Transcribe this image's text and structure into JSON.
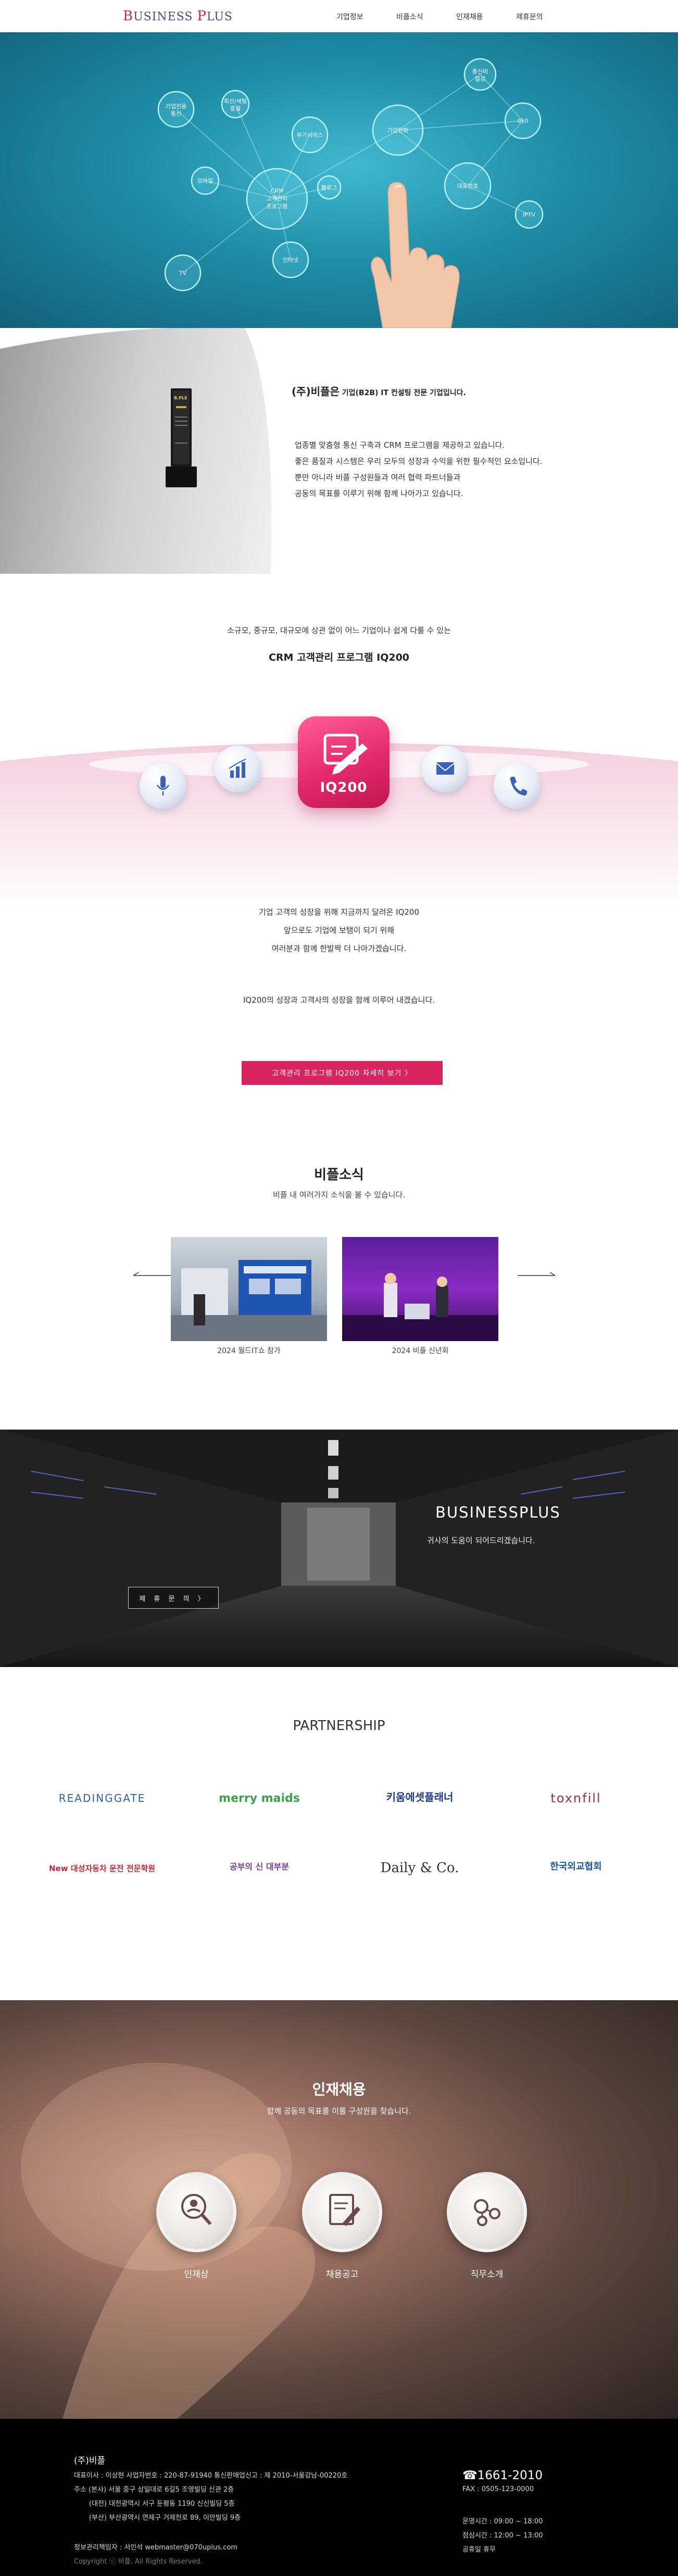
{
  "header": {
    "logo_first": "B",
    "logo_mid": "USINESS ",
    "logo_second": "P",
    "logo_end": "LUS",
    "nav": [
      "기업정보",
      "비플소식",
      "인재채용",
      "제휴문의"
    ]
  },
  "hero": {
    "nodes": [
      "CRM\n고객관리\n프로그램",
      "기업전화",
      "대표번호",
      "050",
      "통신비\n절감",
      "IPTV",
      "부가서비스",
      "회선/세팅\n증설",
      "기업전용\n통신",
      "모바일",
      "블로그",
      "인터넷",
      "TV"
    ]
  },
  "intro": {
    "title_main": "(주)비플은",
    "title_small": " 기업(B2B) IT 컨설팅 전문 기업입니다.",
    "lines": [
      "업종별 맞춤형 통신 구축과 CRM 프로그램을 제공하고 있습니다.",
      "좋은 품질과 시스템은 우리 모두의 성장과 수익을 위한 필수적인 요소입니다.",
      "뿐만 아니라 비플 구성원들과 여러 협력 파트너들과",
      "공동의 목표를 이루기 위해 함께 나아가고 있습니다."
    ],
    "award_label": "B.PLE"
  },
  "crm": {
    "subtitle": "소규모, 중규모, 대규모에 상관 없이 어느 기업이나 쉽게 다룰 수 있는",
    "title": "CRM 고객관리 프로그램 IQ200",
    "product_label": "IQ200",
    "desc_lines": [
      "기업 고객의 성장을 위해 지금까지 달려온 IQ200",
      "앞으로도 기업에 보탬이 되기 위해",
      "여러분과 함께 한발짝 더 나아가겠습니다."
    ],
    "desc2": "IQ200의 성장과 고객사의 성장을 함께 이루어 내겠습니다.",
    "button_label": "고객관리 프로그램 IQ200 자세히 보기  〉"
  },
  "news": {
    "title": "비플소식",
    "subtitle": "비플 내 여러가지 소식을 볼 수 있습니다.",
    "cards": [
      {
        "caption": "2024 월드IT쇼 참가"
      },
      {
        "caption": "2024 비플 신년회"
      }
    ]
  },
  "banner": {
    "title": "BUSINESSPLUS",
    "subtitle": "귀사의 도움이 되어드리겠습니다.",
    "button_label": "제 휴 문 의   〉"
  },
  "partners": {
    "title": "PARTNERSHIP",
    "logos": [
      "READINGGATE",
      "merry maids",
      "키움에셋플래너",
      "toxnfill",
      "New 대성자동차 운전 전문학원",
      "공부의 신 대부분",
      "Daily & Co.",
      "한국외교협회"
    ],
    "logo_colors": [
      "#2e5fae",
      "#3aa34a",
      "#1e3a8a",
      "#a3313a",
      "#c8263a",
      "#7a3e9a",
      "#333333",
      "#1f5a9e"
    ]
  },
  "recruit": {
    "title": "인재채용",
    "subtitle": "함께 공동의 목표를 이룰 구성원을 찾습니다.",
    "items": [
      "인재상",
      "채용공고",
      "직무소개"
    ]
  },
  "footer": {
    "company": "(주)비플",
    "line1": "대표이사 : 이상현     사업자번호 : 220-87-91940     통신판매업신고 : 제 2010-서울강남-00220호",
    "line2": "주소 (본사) 서울 중구 삼일대로 6길5 조영빌딩 신관 2층",
    "line3": "       (대전) 대전광역시 서구 둔평동 1190 신신빌딩 5층",
    "line4": "       (부산) 부산광역시 연제구 거제천로 89, 이안빌딩 9층",
    "line5": "정보관리책임자 : 서인석  webmaster@070uplus.com",
    "copyright": "Copyright ⓒ 비플. All Rights Reserved.",
    "phone": "☎1661-2010",
    "fax": "FAX : 0505-123-0000",
    "hours1": "운영시간 : 09:00 ~ 18:00",
    "hours2": "점심시간 : 12:00 ~ 13:00",
    "hours3": "공휴일 휴무"
  },
  "colors": {
    "accent": "#d8245f",
    "hero_teal": "#1f8ea8",
    "logo_red": "#c8285a",
    "logo_blue": "#4a4a88"
  }
}
